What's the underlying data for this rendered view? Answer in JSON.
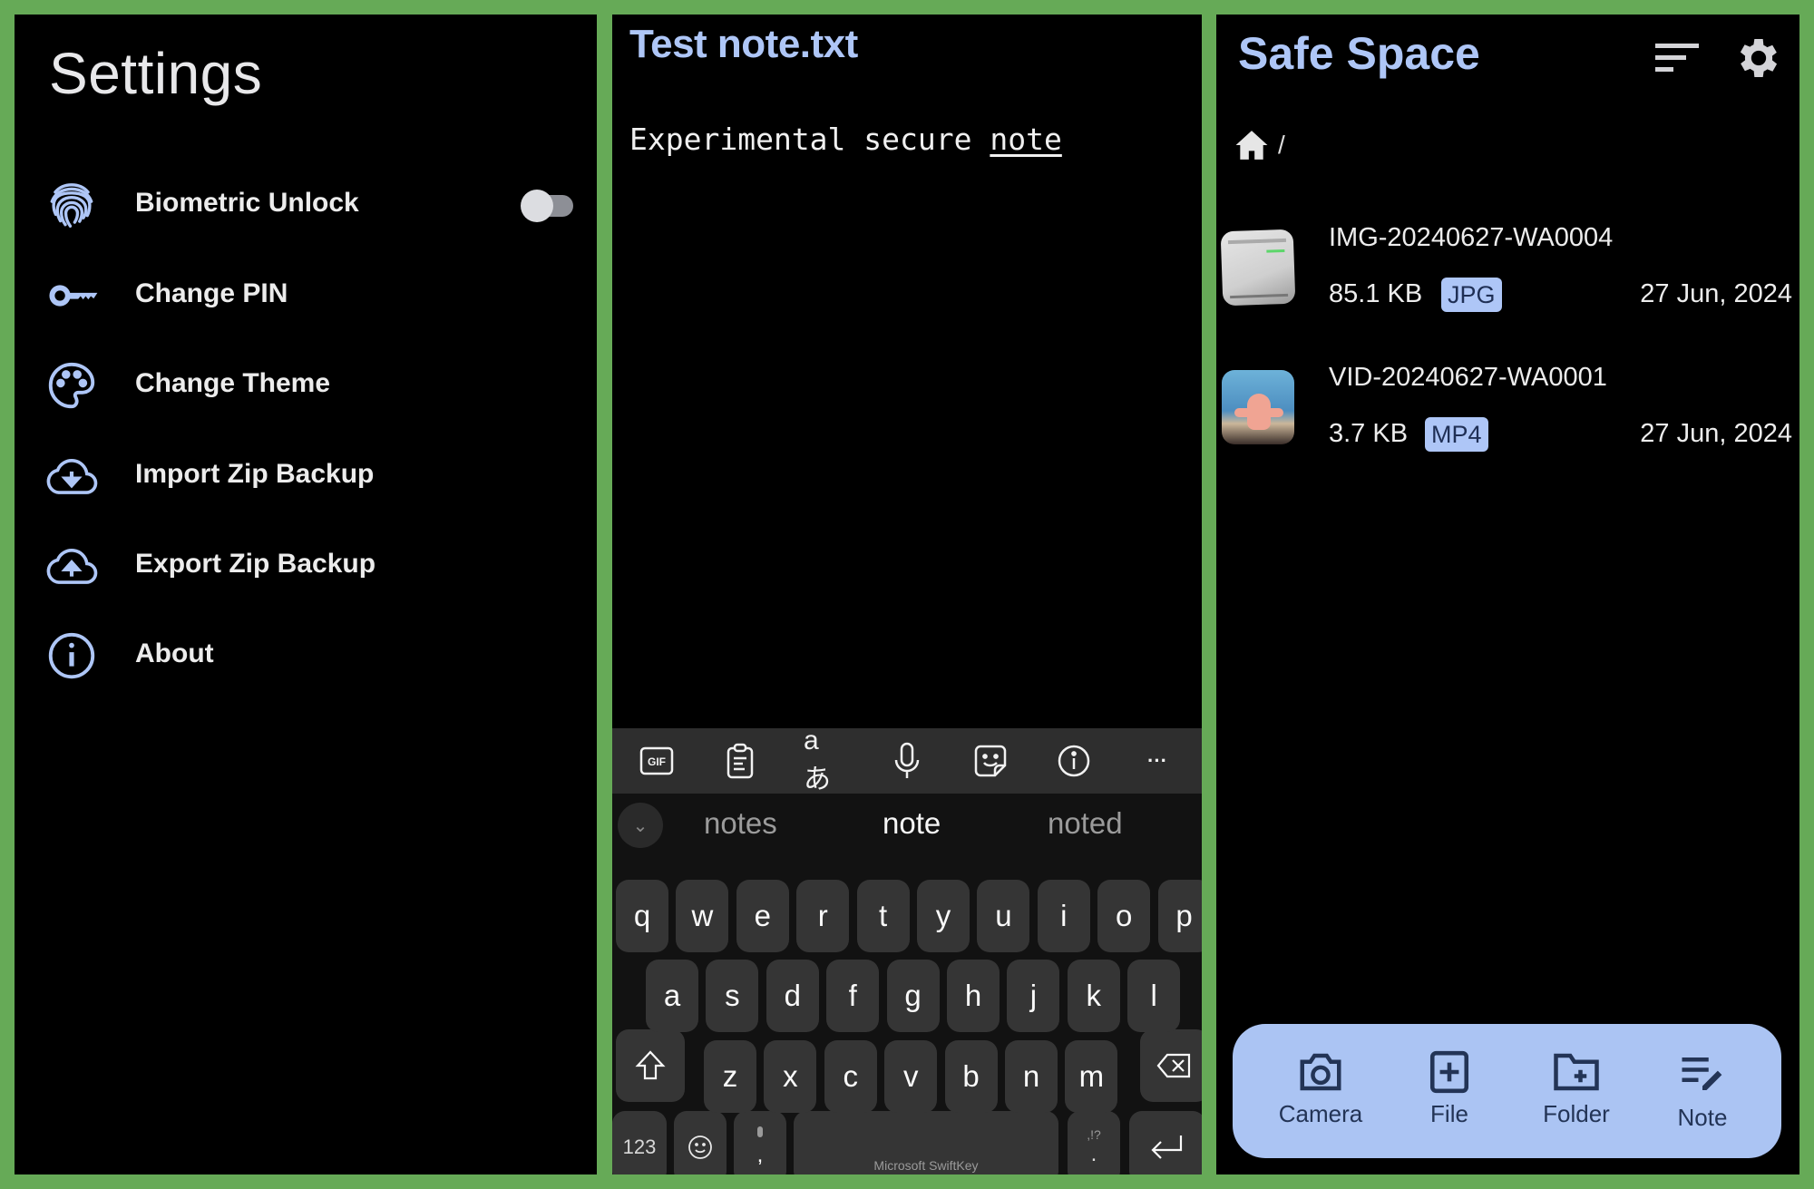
{
  "colors": {
    "frame": "#66aa57",
    "accent": "#aec6f7",
    "panel_bg": "#000000"
  },
  "settings": {
    "title": "Settings",
    "items": [
      {
        "label": "Biometric Unlock",
        "icon": "fingerprint-icon",
        "toggle": false
      },
      {
        "label": "Change PIN",
        "icon": "key-icon"
      },
      {
        "label": "Change Theme",
        "icon": "palette-icon"
      },
      {
        "label": "Import Zip Backup",
        "icon": "cloud-download-icon"
      },
      {
        "label": "Export Zip Backup",
        "icon": "cloud-upload-icon"
      },
      {
        "label": "About",
        "icon": "info-icon"
      }
    ]
  },
  "note": {
    "title": "Test note.txt",
    "body_prefix": "Experimental secure ",
    "body_last_word": "note"
  },
  "keyboard": {
    "toolbar": [
      "gif-icon",
      "clipboard-icon",
      "translate-icon",
      "microphone-icon",
      "sticker-icon",
      "info-icon",
      "more-icon"
    ],
    "gif_label": "GIF",
    "more_label": "···",
    "suggestions": [
      "notes",
      "note",
      "noted"
    ],
    "row1": [
      "q",
      "w",
      "e",
      "r",
      "t",
      "y",
      "u",
      "i",
      "o",
      "p"
    ],
    "row2": [
      "a",
      "s",
      "d",
      "f",
      "g",
      "h",
      "j",
      "k",
      "l"
    ],
    "row3": [
      "z",
      "x",
      "c",
      "v",
      "b",
      "n",
      "m"
    ],
    "numbers_label": "123",
    "comma_label": ",",
    "period_label": ".",
    "punct_hint": ",!?",
    "space_label": "Microsoft SwiftKey"
  },
  "vault": {
    "title": "Safe Space",
    "breadcrumb_sep": "/",
    "files": [
      {
        "name": "IMG-20240627-WA0004",
        "size": "85.1 KB",
        "type": "JPG",
        "date": "27 Jun, 2024"
      },
      {
        "name": "VID-20240627-WA0001",
        "size": "3.7 KB",
        "type": "MP4",
        "date": "27 Jun, 2024"
      }
    ],
    "actions": [
      {
        "label": "Camera",
        "icon": "camera-icon"
      },
      {
        "label": "File",
        "icon": "file-add-icon"
      },
      {
        "label": "Folder",
        "icon": "folder-add-icon"
      },
      {
        "label": "Note",
        "icon": "note-edit-icon"
      }
    ]
  }
}
